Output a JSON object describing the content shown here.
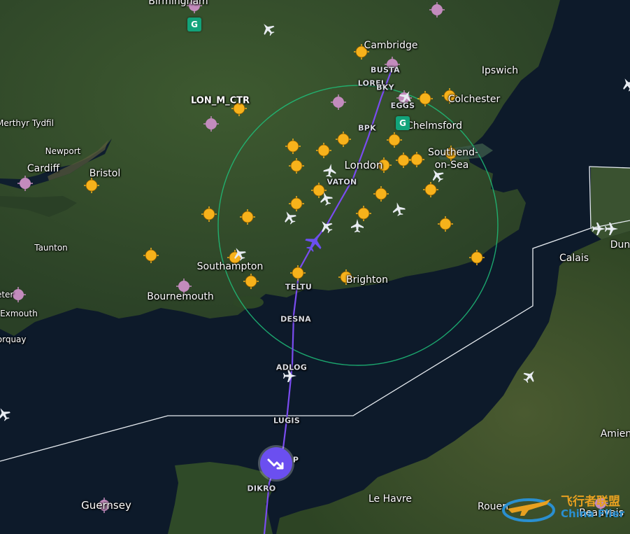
{
  "map": {
    "colors": {
      "sea": "#0d1a2a",
      "land": "#2f4a2a",
      "airspace_border": "#e6ebf0",
      "range_ring": "#1fbf7a",
      "route": "#7a4cf0",
      "airport": "#f7b21b",
      "waypoint_marker": "#c38bbd",
      "selected_aircraft": "#6b4ff0"
    },
    "sector_label": "LON_M_CTR",
    "cities": [
      {
        "id": "birmingham",
        "name": "Birmingham"
      },
      {
        "id": "cambridge",
        "name": "Cambridge"
      },
      {
        "id": "ipswich",
        "name": "Ipswich"
      },
      {
        "id": "colchester",
        "name": "Colchester"
      },
      {
        "id": "chelmsford",
        "name": "Chelmsford"
      },
      {
        "id": "southend",
        "name": "Southend-"
      },
      {
        "id": "southend2",
        "name": "on-Sea"
      },
      {
        "id": "london",
        "name": "London"
      },
      {
        "id": "merthyr",
        "name": "Merthyr Tydfil"
      },
      {
        "id": "newport",
        "name": "Newport"
      },
      {
        "id": "cardiff",
        "name": "Cardiff"
      },
      {
        "id": "bristol",
        "name": "Bristol"
      },
      {
        "id": "taunton",
        "name": "Taunton"
      },
      {
        "id": "southampton",
        "name": "Southampton"
      },
      {
        "id": "bournemouth",
        "name": "Bournemouth"
      },
      {
        "id": "brighton",
        "name": "Brighton"
      },
      {
        "id": "exeter",
        "name": "Exeter"
      },
      {
        "id": "exmouth",
        "name": "Exmouth"
      },
      {
        "id": "torquay",
        "name": "Torquay"
      },
      {
        "id": "calais",
        "name": "Calais"
      },
      {
        "id": "dunkirk",
        "name": "Dun"
      },
      {
        "id": "amiens",
        "name": "Amien"
      },
      {
        "id": "lehavre",
        "name": "Le Havre"
      },
      {
        "id": "rouen",
        "name": "Rouen"
      },
      {
        "id": "beauvais",
        "name": "Beauvais"
      },
      {
        "id": "guernsey",
        "name": "Guernsey"
      }
    ],
    "waypoints": [
      {
        "id": "busta",
        "name": "BUSTA"
      },
      {
        "id": "lorel",
        "name": "LOREL"
      },
      {
        "id": "bky",
        "name": "BKY"
      },
      {
        "id": "eggs",
        "name": "EGGS"
      },
      {
        "id": "bpk",
        "name": "BPK"
      },
      {
        "id": "vaton",
        "name": "VATON"
      },
      {
        "id": "teltu",
        "name": "TELTU"
      },
      {
        "id": "desna",
        "name": "DESNA"
      },
      {
        "id": "adlog",
        "name": "ADLOG"
      },
      {
        "id": "lugis",
        "name": "LUGIS"
      },
      {
        "id": "dikro",
        "name": "DIKRO"
      },
      {
        "id": "p",
        "name": "P"
      }
    ],
    "ground_badge_label": "G",
    "watermark": {
      "cn": "飞行者联盟",
      "en": "China Flier"
    }
  }
}
